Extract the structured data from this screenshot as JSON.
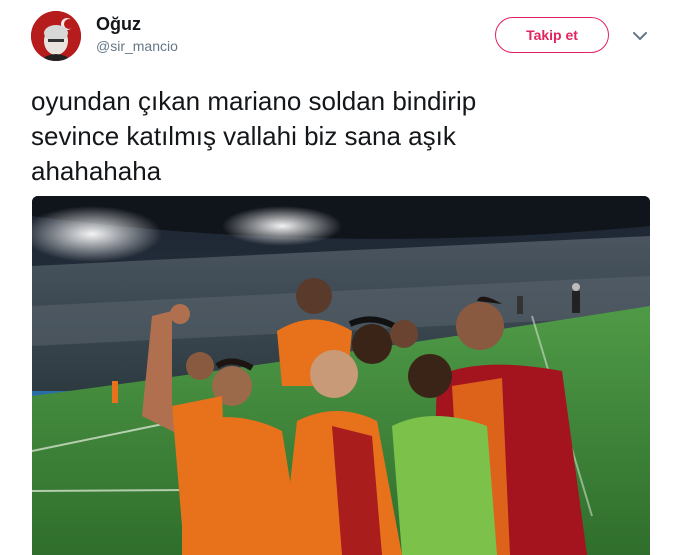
{
  "tweet": {
    "author_name": "Oğuz",
    "author_handle": "@sir_mancio",
    "text": "oyundan çıkan mariano soldan bindirip\nsevince katılmış vallahi biz sana  aşık\nahahahaha"
  },
  "actions": {
    "follow_label": "Takip et",
    "more_icon": "chevron-down-icon"
  },
  "media": {
    "description_icon": "photo"
  },
  "colors": {
    "accent": "#e0245e",
    "handle": "#657786",
    "text": "#14171a",
    "team_orange": "#e8711b",
    "team_red": "#a3141e",
    "pitch": "#3f8a3a"
  }
}
